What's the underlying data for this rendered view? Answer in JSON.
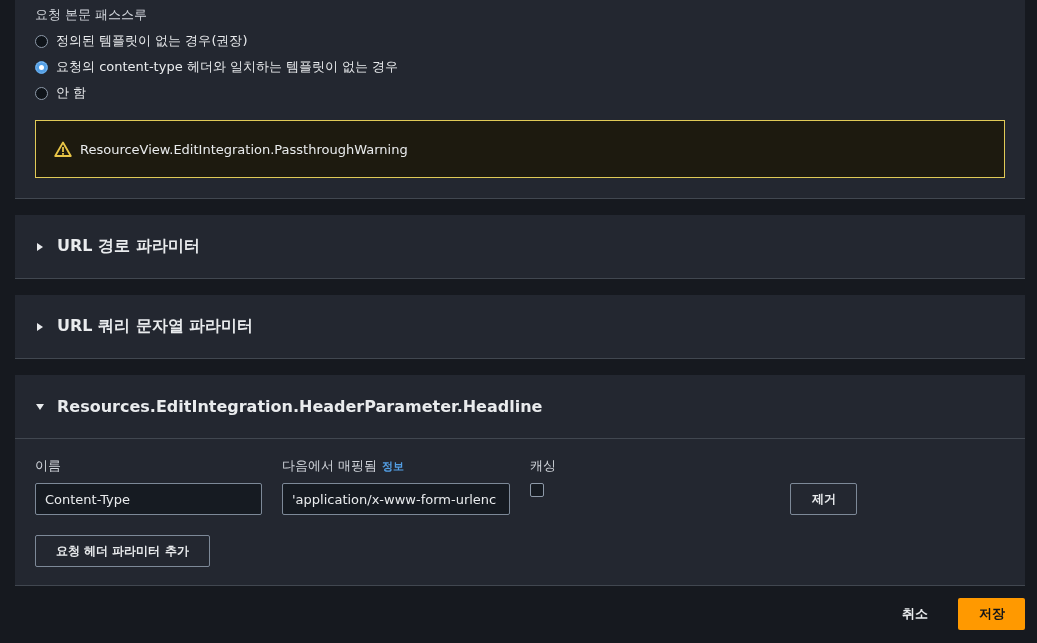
{
  "passthrough": {
    "label": "요청 본문 패스스루",
    "options": [
      {
        "label": "정의된 템플릿이 없는 경우(권장)",
        "selected": false
      },
      {
        "label": "요청의 content-type 헤더와 일치하는 템플릿이 없는 경우",
        "selected": true
      },
      {
        "label": "안 함",
        "selected": false
      }
    ],
    "warning": "ResourceView.EditIntegration.PassthroughWarning"
  },
  "sections": [
    {
      "title": "URL 경로 파라미터",
      "expanded": false
    },
    {
      "title": "URL 쿼리 문자열 파라미터",
      "expanded": false
    },
    {
      "title": "Resources.EditIntegration.HeaderParameter.Headline",
      "expanded": true,
      "columns": {
        "name": "이름",
        "mapped_from": "다음에서 매핑됨",
        "info": "정보",
        "caching": "캐싱"
      },
      "rows": [
        {
          "name": "Content-Type",
          "mapped_from": "'application/x-www-form-urlenc",
          "caching": false,
          "remove": "제거"
        }
      ],
      "add_button": "요청 헤더 파라미터 추가"
    }
  ],
  "footer": {
    "cancel": "취소",
    "save": "저장"
  }
}
